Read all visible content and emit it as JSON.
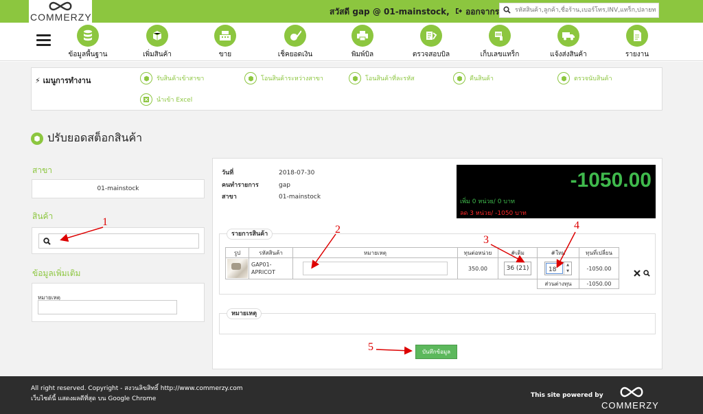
{
  "brand": {
    "name": "COMMERZY"
  },
  "topbar": {
    "greeting": "สวัสดี gap @ 01-mainstock,",
    "logout_label": "ออกจากระบบ",
    "search_placeholder": "รหัสสินค้า,ลูกค้า,ชื่อร้าน,เบอร์โทร,INV,แทร็ก,ปลายทาง"
  },
  "nav": {
    "items": [
      {
        "label": "ข้อมูลพื้นฐาน",
        "icon": "database-icon"
      },
      {
        "label": "เพิ่มสินค้า",
        "icon": "box-icon"
      },
      {
        "label": "ขาย",
        "icon": "cash-register-icon"
      },
      {
        "label": "เช็คยอดเงิน",
        "icon": "check-money-icon"
      },
      {
        "label": "พิมพ์บิล",
        "icon": "printer-icon"
      },
      {
        "label": "ตรวจสอบบิล",
        "icon": "scan-icon"
      },
      {
        "label": "เก็บเลขแทร็ก",
        "icon": "barcode-scanner-icon"
      },
      {
        "label": "แจ้งส่งสินค้า",
        "icon": "truck-icon"
      },
      {
        "label": "รายงาน",
        "icon": "report-icon"
      }
    ]
  },
  "menu": {
    "title": "เมนูการทำงาน",
    "links": [
      {
        "label": "รับสินค้าเข้าสาขา"
      },
      {
        "label": "โอนสินค้าระหว่างสาขา"
      },
      {
        "label": "โอนสินค้าที่ละรหัส"
      },
      {
        "label": "คืนสินค้า"
      },
      {
        "label": "ตรวจนับสินค้า"
      },
      {
        "label": "นำเข้า Excel"
      }
    ]
  },
  "page": {
    "title": "ปรับยอดสต็อกสินค้า"
  },
  "left": {
    "branch_label": "สาขา",
    "branch_value": "01-mainstock",
    "product_label": "สินค้า",
    "extra_label": "ข้อมูลเพิ่มเติม",
    "note_label": "หมายเหตุ"
  },
  "info": {
    "date_key": "วันที่",
    "date_val": "2018-07-30",
    "user_key": "คนทำรายการ",
    "user_val": "gap",
    "branch_key": "สาขา",
    "branch_val": "01-mainstock"
  },
  "summary": {
    "total": "-1050.00",
    "add_line": "เพิ่ม 0 หน่วย/ 0 บาท",
    "sub_line": "ลด 3 หน่วย/ -1050 บาท"
  },
  "items": {
    "legend": "รายการสินค้า",
    "headers": [
      "รูป",
      "รหัสสินค้า",
      "หมายเหตุ",
      "ทุนต่อหน่วย",
      "#เดิม",
      "#ใหม่",
      "ทุนที่เปลี่ยน"
    ],
    "row": {
      "code": "GAP01-APRICOT",
      "note": "",
      "unit_cost": "350.00",
      "original": "36 (21)",
      "new_qty": "18",
      "cost_change": "-1050.00"
    },
    "diff_label": "ส่วนต่างทุน",
    "diff_value": "-1050.00"
  },
  "note_section": {
    "legend": "หมายเหตุ"
  },
  "save_label": "บันทึกข้อมูล",
  "annotations": [
    "1",
    "2",
    "3",
    "4",
    "5"
  ],
  "footer": {
    "line1": "All right reserved. Copyright - สงวนลิขสิทธิ์ http://www.commerzy.com",
    "line2": "เว็บไซต์นี้ แสดงผลดีที่สุด บน Google Chrome",
    "powered": "This site powered by",
    "logo": "COMMERZY"
  },
  "colors": {
    "accent": "#8cc63f",
    "save": "#5cb85c",
    "dark": "#2d2d2d",
    "positive": "#3fb94c",
    "negative": "#ff2a2a",
    "annotation": "#dd0000"
  }
}
